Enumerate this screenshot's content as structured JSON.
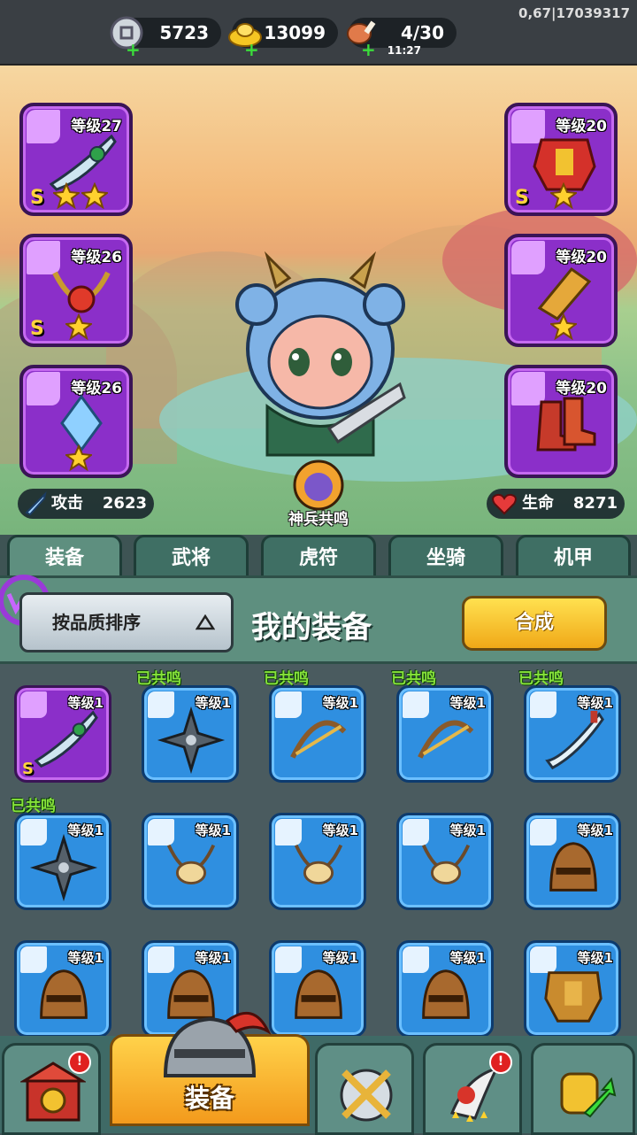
{
  "top_bar": {
    "silver": "5723",
    "gold": "13099",
    "stamina": "4/30",
    "stamina_timer": "11:27",
    "user_id": "0,67|17039317"
  },
  "hero": {
    "left_slots": [
      {
        "level": "等级27",
        "rank": "S",
        "stars": 2,
        "type": "weapon"
      },
      {
        "level": "等级26",
        "rank": "S",
        "stars": 1,
        "type": "amulet"
      },
      {
        "level": "等级26",
        "rank": "",
        "stars": 1,
        "type": "helmet"
      }
    ],
    "right_slots": [
      {
        "level": "等级20",
        "rank": "S",
        "stars": 1,
        "type": "armor"
      },
      {
        "level": "等级20",
        "rank": "",
        "stars": 1,
        "type": "gauntlet"
      },
      {
        "level": "等级20",
        "rank": "",
        "stars": 0,
        "type": "boots"
      }
    ],
    "resonance_label": "神兵共鸣",
    "attack_label": "攻击",
    "attack_value": "2623",
    "hp_label": "生命",
    "hp_value": "8271"
  },
  "tabs": [
    "装备",
    "武将",
    "虎符",
    "坐骑",
    "机甲"
  ],
  "sort_bar": {
    "sort_label": "按品质排序",
    "title": "我的装备",
    "merge_label": "合成"
  },
  "inventory": [
    {
      "level": "等级1",
      "rank": "S",
      "quality": "purple",
      "type": "sword",
      "resonated": ""
    },
    {
      "level": "等级1",
      "rank": "",
      "quality": "blue",
      "type": "shuriken",
      "resonated": "已共鸣"
    },
    {
      "level": "等级1",
      "rank": "",
      "quality": "blue",
      "type": "crossbow",
      "resonated": "已共鸣"
    },
    {
      "level": "等级1",
      "rank": "",
      "quality": "blue",
      "type": "crossbow",
      "resonated": "已共鸣"
    },
    {
      "level": "等级1",
      "rank": "",
      "quality": "blue",
      "type": "blade",
      "resonated": "已共鸣"
    },
    {
      "level": "等级1",
      "rank": "",
      "quality": "blue",
      "type": "shuriken",
      "resonated": "已共鸣"
    },
    {
      "level": "等级1",
      "rank": "",
      "quality": "blue",
      "type": "amulet",
      "resonated": ""
    },
    {
      "level": "等级1",
      "rank": "",
      "quality": "blue",
      "type": "amulet",
      "resonated": ""
    },
    {
      "level": "等级1",
      "rank": "",
      "quality": "blue",
      "type": "amulet",
      "resonated": ""
    },
    {
      "level": "等级1",
      "rank": "",
      "quality": "blue",
      "type": "helmet",
      "resonated": ""
    },
    {
      "level": "等级1",
      "rank": "",
      "quality": "blue",
      "type": "helmet",
      "resonated": ""
    },
    {
      "level": "等级1",
      "rank": "",
      "quality": "blue",
      "type": "helmet",
      "resonated": ""
    },
    {
      "level": "等级1",
      "rank": "",
      "quality": "blue",
      "type": "helmet",
      "resonated": ""
    },
    {
      "level": "等级1",
      "rank": "",
      "quality": "blue",
      "type": "helmet",
      "resonated": ""
    },
    {
      "level": "等级1",
      "rank": "",
      "quality": "blue",
      "type": "armor",
      "resonated": ""
    }
  ],
  "bottom_nav": {
    "active_label": "装备",
    "badges": [
      "!",
      "!"
    ]
  },
  "colors": {
    "purple_quality": "#8b2fc9",
    "blue_quality": "#2f8fe0",
    "gold_button": "#f0a818",
    "resonance_green": "#86e23a"
  }
}
